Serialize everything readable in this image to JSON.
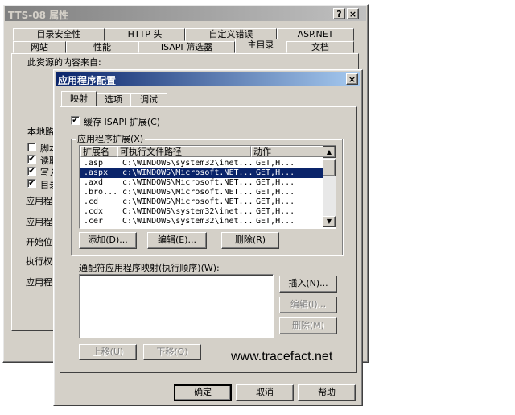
{
  "outer": {
    "title": "TTS-08 属性",
    "help_glyph": "?",
    "close_glyph": "×",
    "tabs_back": [
      "目录安全性",
      "HTTP 头",
      "自定义错误",
      "ASP.NET"
    ],
    "tabs_front": [
      "网站",
      "性能",
      "ISAPI 筛选器",
      "主目录",
      "文档"
    ],
    "content_from": "此资源的内容来自:",
    "local_path_label": "本地路",
    "checks": [
      {
        "label": "脚本",
        "checked": false
      },
      {
        "label": "读取",
        "checked": true
      },
      {
        "label": "写入",
        "checked": true
      },
      {
        "label": "目录",
        "checked": true
      }
    ],
    "left_labels": [
      "应用程",
      "应用程",
      "开始位",
      "执行权",
      "应用程"
    ]
  },
  "dialog": {
    "title": "应用程序配置",
    "close_glyph": "×",
    "tabs": [
      "映射",
      "选项",
      "调试"
    ],
    "cache_label": "缓存 ISAPI 扩展(C)",
    "cache_checked": true,
    "group_label": "应用程序扩展(X)",
    "columns": [
      "扩展名",
      "可执行文件路径",
      "动作"
    ],
    "rows": [
      {
        "ext": ".asp",
        "path": "C:\\WINDOWS\\system32\\inet...",
        "verbs": "GET,H..."
      },
      {
        "ext": ".aspx",
        "path": "c:\\WINDOWS\\Microsoft.NET...",
        "verbs": "GET,H..."
      },
      {
        "ext": ".axd",
        "path": "c:\\WINDOWS\\Microsoft.NET...",
        "verbs": "GET,H..."
      },
      {
        "ext": ".bro...",
        "path": "c:\\WINDOWS\\Microsoft.NET...",
        "verbs": "GET,H..."
      },
      {
        "ext": ".cd",
        "path": "c:\\WINDOWS\\Microsoft.NET...",
        "verbs": "GET,H..."
      },
      {
        "ext": ".cdx",
        "path": "C:\\WINDOWS\\system32\\inet...",
        "verbs": "GET,H..."
      },
      {
        "ext": ".cer",
        "path": "C:\\WINDOWS\\system32\\inet...",
        "verbs": "GET,H..."
      }
    ],
    "selected_index": 1,
    "add": "添加(D)...",
    "edit": "编辑(E)...",
    "remove": "删除(R)",
    "wildcard_label": "通配符应用程序映射(执行顺序)(W):",
    "insert": "插入(N)...",
    "wc_edit": "编辑(I)...",
    "wc_remove": "删除(M)",
    "move_up": "上移(U)",
    "move_down": "下移(O)",
    "watermark": "www.tracefact.net",
    "ok": "确定",
    "cancel": "取消",
    "help": "帮助"
  },
  "colors": {
    "dialog_title_bg": "#0a246a",
    "outer_title_bg": "#808080",
    "selection": "#0a246a"
  }
}
